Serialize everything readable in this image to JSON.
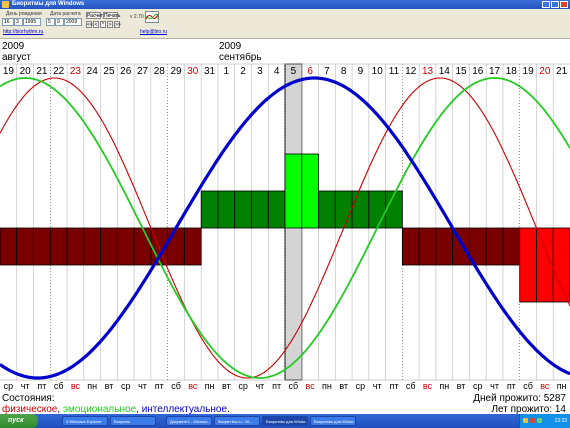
{
  "window": {
    "title": "Биоритмы для Windows"
  },
  "toolbar": {
    "birth_label": "День рождения",
    "birth_day": "16",
    "birth_month": "3",
    "birth_year": "1995",
    "calc_label": "Дата расчета",
    "calc_day": "5",
    "calc_month": "9",
    "calc_year": "2009",
    "calc_button": "Расчет",
    "print_button": "Печать",
    "nav_buttons": [
      "<<",
      "<",
      "*",
      ">",
      ">>"
    ],
    "version": "v 2.70",
    "site_left": "http://biorhythm.ru",
    "site_right": "help@bio.ru"
  },
  "chart_data": {
    "type": "line",
    "title": "",
    "birth_date": "1995-03-16",
    "selected_date": "2009-09-05",
    "year_left": "2009",
    "month_left": "август",
    "year_mid": "2009",
    "month_mid": "сентябрь",
    "days": [
      "19",
      "20",
      "21",
      "22",
      "23",
      "24",
      "25",
      "26",
      "27",
      "28",
      "29",
      "30",
      "31",
      "1",
      "2",
      "3",
      "4",
      "5",
      "6",
      "7",
      "8",
      "9",
      "10",
      "11",
      "12",
      "13",
      "14",
      "15",
      "16",
      "17",
      "18",
      "19",
      "20",
      "21"
    ],
    "weekdays": [
      "ср",
      "чт",
      "пт",
      "сб",
      "вс",
      "пн",
      "вт",
      "ср",
      "чт",
      "пт",
      "сб",
      "вс",
      "пн",
      "вт",
      "ср",
      "чт",
      "пт",
      "сб",
      "вс",
      "пн",
      "вт",
      "ср",
      "чт",
      "пт",
      "сб",
      "вс",
      "пн",
      "вт",
      "ср",
      "чт",
      "пт",
      "сб",
      "вс",
      "пн"
    ],
    "sundays_index": [
      4,
      11,
      18,
      25,
      32
    ],
    "dotted_index": [
      3,
      10,
      17,
      24,
      31
    ],
    "series": [
      {
        "name": "физическое",
        "period": 23,
        "color": "#cc0000"
      },
      {
        "name": "эмоциональное",
        "period": 28,
        "color": "#22cc22"
      },
      {
        "name": "интеллектуальное",
        "period": 33,
        "color": "#0000cc"
      }
    ],
    "bars": [
      {
        "from": 0,
        "to": 11,
        "level": -1,
        "color": "#7a0000"
      },
      {
        "from": 12,
        "to": 16,
        "level": 1,
        "color": "#008000"
      },
      {
        "from": 17,
        "to": 18,
        "level": 2,
        "color": "#00ff00"
      },
      {
        "from": 19,
        "to": 23,
        "level": 1,
        "color": "#008000"
      },
      {
        "from": 24,
        "to": 30,
        "level": -1,
        "color": "#7a0000"
      },
      {
        "from": 31,
        "to": 33,
        "level": -2,
        "color": "#ff0000"
      }
    ]
  },
  "footer": {
    "states_label": "Состояния:",
    "legend_physical": "физическое",
    "legend_emotional": "эмоциональное",
    "legend_intellectual": "интеллектуальное",
    "sep": ", ",
    "end": ".",
    "days_lived_label": "Дней прожито: ",
    "days_lived": "5287",
    "years_lived_label": "Лет прожито: ",
    "years_lived": "14"
  },
  "taskbar": {
    "start": "пуск",
    "tasks": [
      "3 Windows Explorer",
      "Биоритм",
      "Документ1 - Microso...",
      "биорит.bio.ru - W...",
      "Биоритмы для Windo...",
      "Биоритмы для Windo..."
    ],
    "clock": "13:33"
  }
}
